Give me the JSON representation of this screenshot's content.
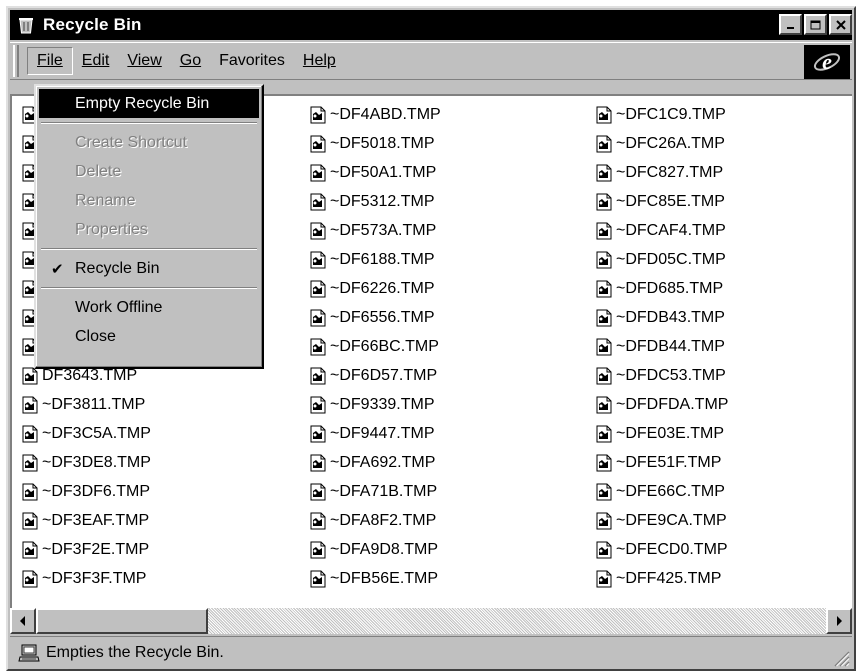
{
  "window": {
    "title": "Recycle Bin",
    "buttons": {
      "minimize": "_",
      "maximize": "□",
      "close": "✕"
    }
  },
  "menubar": {
    "items": [
      {
        "label": "File",
        "name": "menu-file",
        "active": true
      },
      {
        "label": "Edit",
        "name": "menu-edit"
      },
      {
        "label": "View",
        "name": "menu-view"
      },
      {
        "label": "Go",
        "name": "menu-go"
      },
      {
        "label": "Favorites",
        "name": "menu-favorites"
      },
      {
        "label": "Help",
        "name": "menu-help"
      }
    ]
  },
  "file_menu": {
    "items": [
      {
        "type": "item",
        "label": "Empty Recycle Bin",
        "name": "menu-item-empty-recycle-bin",
        "highlighted": true
      },
      {
        "type": "separator"
      },
      {
        "type": "item",
        "label": "Create Shortcut",
        "name": "menu-item-create-shortcut",
        "disabled": true
      },
      {
        "type": "item",
        "label": "Delete",
        "name": "menu-item-delete",
        "disabled": true
      },
      {
        "type": "item",
        "label": "Rename",
        "name": "menu-item-rename",
        "disabled": true
      },
      {
        "type": "item",
        "label": "Properties",
        "name": "menu-item-properties",
        "disabled": true
      },
      {
        "type": "separator"
      },
      {
        "type": "item",
        "label": "Recycle Bin",
        "name": "menu-item-recycle-bin",
        "checked": true
      },
      {
        "type": "separator"
      },
      {
        "type": "item",
        "label": "Work Offline",
        "name": "menu-item-work-offline"
      },
      {
        "type": "item",
        "label": "Close",
        "name": "menu-item-close"
      }
    ]
  },
  "files": {
    "columns": [
      [
        "",
        "",
        "",
        "",
        "",
        "",
        "",
        "",
        "",
        "DF3643.TMP",
        "~DF3811.TMP",
        "~DF3C5A.TMP",
        "~DF3DE8.TMP",
        "~DF3DF6.TMP",
        "~DF3EAF.TMP",
        "~DF3F2E.TMP",
        "~DF3F3F.TMP"
      ],
      [
        "~DF4ABD.TMP",
        "~DF5018.TMP",
        "~DF50A1.TMP",
        "~DF5312.TMP",
        "~DF573A.TMP",
        "~DF6188.TMP",
        "~DF6226.TMP",
        "~DF6556.TMP",
        "~DF66BC.TMP",
        "~DF6D57.TMP",
        "~DF9339.TMP",
        "~DF9447.TMP",
        "~DFA692.TMP",
        "~DFA71B.TMP",
        "~DFA8F2.TMP",
        "~DFA9D8.TMP",
        "~DFB56E.TMP"
      ],
      [
        "~DFC1C9.TMP",
        "~DFC26A.TMP",
        "~DFC827.TMP",
        "~DFC85E.TMP",
        "~DFCAF4.TMP",
        "~DFD05C.TMP",
        "~DFD685.TMP",
        "~DFDB43.TMP",
        "~DFDB44.TMP",
        "~DFDC53.TMP",
        "~DFDFDA.TMP",
        "~DFE03E.TMP",
        "~DFE51F.TMP",
        "~DFE66C.TMP",
        "~DFE9CA.TMP",
        "~DFECD0.TMP",
        "~DFF425.TMP"
      ]
    ]
  },
  "statusbar": {
    "text": "Empties the Recycle Bin."
  },
  "icons": {
    "app": "recycle-bin-icon",
    "file": "tmp-file-icon",
    "browser_logo": "internet-explorer-logo",
    "status": "computer-icon"
  }
}
